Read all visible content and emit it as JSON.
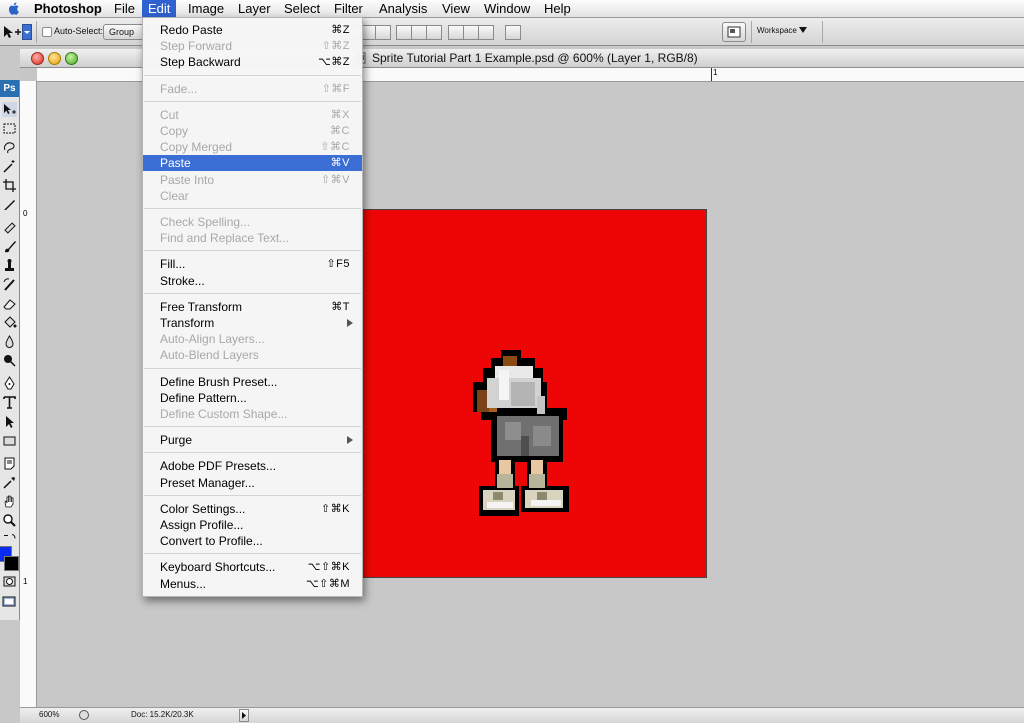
{
  "menubar": {
    "items": [
      "Photoshop",
      "File",
      "Edit",
      "Image",
      "Layer",
      "Select",
      "Filter",
      "Analysis",
      "View",
      "Window",
      "Help"
    ],
    "active": "Edit"
  },
  "options_bar": {
    "auto_select_label": "Auto-Select:",
    "auto_select_value": "Group",
    "workspace_label": "Workspace"
  },
  "document": {
    "title": "Sprite Tutorial Part 1 Example.psd @ 600% (Layer 1, RGB/8)",
    "ruler_h_label": "1",
    "ruler_v_labels": [
      "0",
      "1"
    ],
    "zoom": "600%",
    "doc_size": "Doc: 15.2K/20.3K",
    "canvas_color": "#ee0606"
  },
  "toolbox": {
    "badge": "Ps",
    "foreground_color": "#0a2cf0",
    "background_color": "#000000"
  },
  "edit_menu": [
    {
      "label": "Redo Paste",
      "shortcut": "⌘Z",
      "enabled": true
    },
    {
      "label": "Step Forward",
      "shortcut": "⇧⌘Z",
      "enabled": false
    },
    {
      "label": "Step Backward",
      "shortcut": "⌥⌘Z",
      "enabled": true
    },
    {
      "sep": true
    },
    {
      "label": "Fade...",
      "shortcut": "⇧⌘F",
      "enabled": false
    },
    {
      "sep": true
    },
    {
      "label": "Cut",
      "shortcut": "⌘X",
      "enabled": false
    },
    {
      "label": "Copy",
      "shortcut": "⌘C",
      "enabled": false
    },
    {
      "label": "Copy Merged",
      "shortcut": "⇧⌘C",
      "enabled": false
    },
    {
      "label": "Paste",
      "shortcut": "⌘V",
      "enabled": true,
      "selected": true
    },
    {
      "label": "Paste Into",
      "shortcut": "⇧⌘V",
      "enabled": false
    },
    {
      "label": "Clear",
      "shortcut": "",
      "enabled": false
    },
    {
      "sep": true
    },
    {
      "label": "Check Spelling...",
      "shortcut": "",
      "enabled": false
    },
    {
      "label": "Find and Replace Text...",
      "shortcut": "",
      "enabled": false
    },
    {
      "sep": true
    },
    {
      "label": "Fill...",
      "shortcut": "⇧F5",
      "enabled": true
    },
    {
      "label": "Stroke...",
      "shortcut": "",
      "enabled": true
    },
    {
      "sep": true
    },
    {
      "label": "Free Transform",
      "shortcut": "⌘T",
      "enabled": true
    },
    {
      "label": "Transform",
      "shortcut": "",
      "enabled": true,
      "submenu": true
    },
    {
      "label": "Auto-Align Layers...",
      "shortcut": "",
      "enabled": false
    },
    {
      "label": "Auto-Blend Layers",
      "shortcut": "",
      "enabled": false
    },
    {
      "sep": true
    },
    {
      "label": "Define Brush Preset...",
      "shortcut": "",
      "enabled": true
    },
    {
      "label": "Define Pattern...",
      "shortcut": "",
      "enabled": true
    },
    {
      "label": "Define Custom Shape...",
      "shortcut": "",
      "enabled": false
    },
    {
      "sep": true
    },
    {
      "label": "Purge",
      "shortcut": "",
      "enabled": true,
      "submenu": true
    },
    {
      "sep": true
    },
    {
      "label": "Adobe PDF Presets...",
      "shortcut": "",
      "enabled": true
    },
    {
      "label": "Preset Manager...",
      "shortcut": "",
      "enabled": true
    },
    {
      "sep": true
    },
    {
      "label": "Color Settings...",
      "shortcut": "⇧⌘K",
      "enabled": true
    },
    {
      "label": "Assign Profile...",
      "shortcut": "",
      "enabled": true
    },
    {
      "label": "Convert to Profile...",
      "shortcut": "",
      "enabled": true
    },
    {
      "sep": true
    },
    {
      "label": "Keyboard Shortcuts...",
      "shortcut": "⌥⇧⌘K",
      "enabled": true
    },
    {
      "label": "Menus...",
      "shortcut": "⌥⇧⌘M",
      "enabled": true
    }
  ]
}
